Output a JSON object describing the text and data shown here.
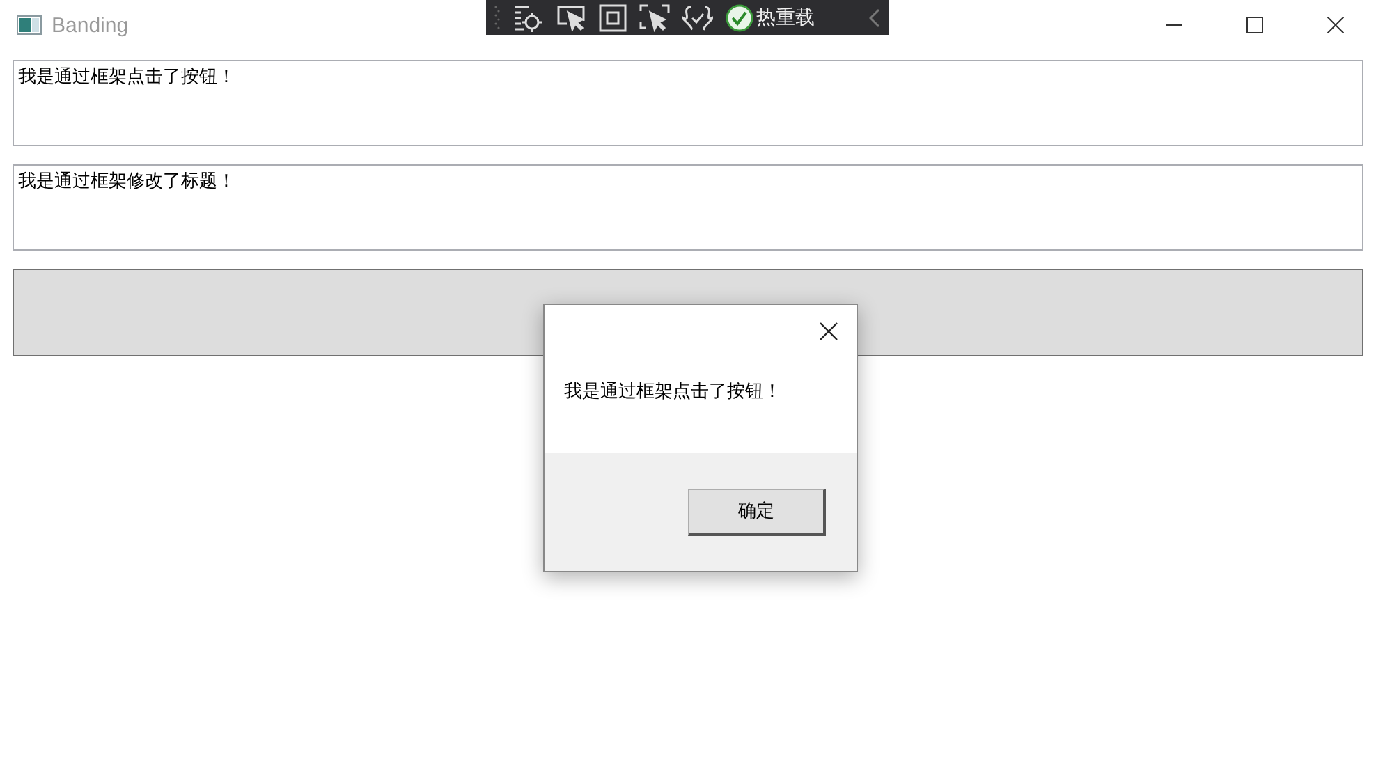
{
  "window": {
    "title": "Banding"
  },
  "debug_toolbar": {
    "hot_reload_label": "热重载"
  },
  "text_boxes": [
    {
      "value": "我是通过框架点击了按钮！"
    },
    {
      "value": "我是通过框架修改了标题！"
    }
  ],
  "dialog": {
    "message": "我是通过框架点击了按钮！",
    "buttons": [
      "确定"
    ]
  }
}
